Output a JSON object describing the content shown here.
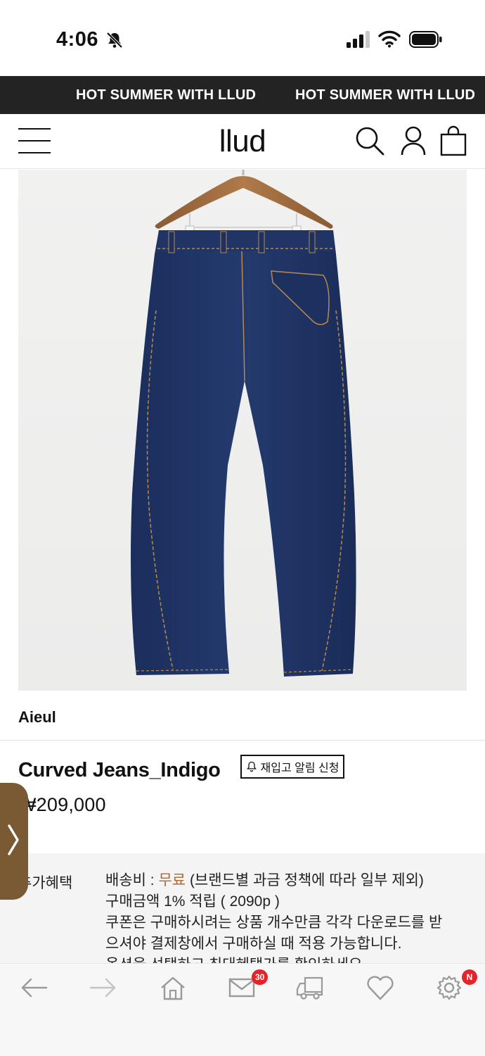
{
  "status_bar": {
    "time": "4:06"
  },
  "promo": {
    "messages": [
      "HOT SUMMER WITH LLUD",
      "HOT SUMMER WITH LLUD"
    ]
  },
  "header": {
    "logo": "llud"
  },
  "product": {
    "image_alt": "indigo curved jeans on wooden hanger",
    "brand": "Aieul",
    "title": "Curved Jeans_Indigo",
    "restock_label": "재입고 알림 신청",
    "price": "₩209,000"
  },
  "benefits": {
    "label": "추가혜택",
    "shipping_prefix": "배송비 : ",
    "shipping_free": "무료",
    "shipping_suffix": " (브랜드별 과금 정책에 따라 일부 제외)",
    "points": "구매금액 1% 적립 ( 2090p )",
    "coupon_line1": "쿠폰은 구매하시려는 상품 개수만큼 각각 다운로드를 받",
    "coupon_line2": "으셔야 결제창에서 구매하실 때 적용 가능합니다.",
    "coupon_line3": "옵션을 선택하고 최대혜택가를 확인하세요."
  },
  "bottom_nav": {
    "mail_badge": "30",
    "settings_badge": "N"
  },
  "colors": {
    "promo_bg": "#232323",
    "side_tab": "#7a5a32",
    "badge": "#e2242b",
    "denim": "#1f3566"
  }
}
